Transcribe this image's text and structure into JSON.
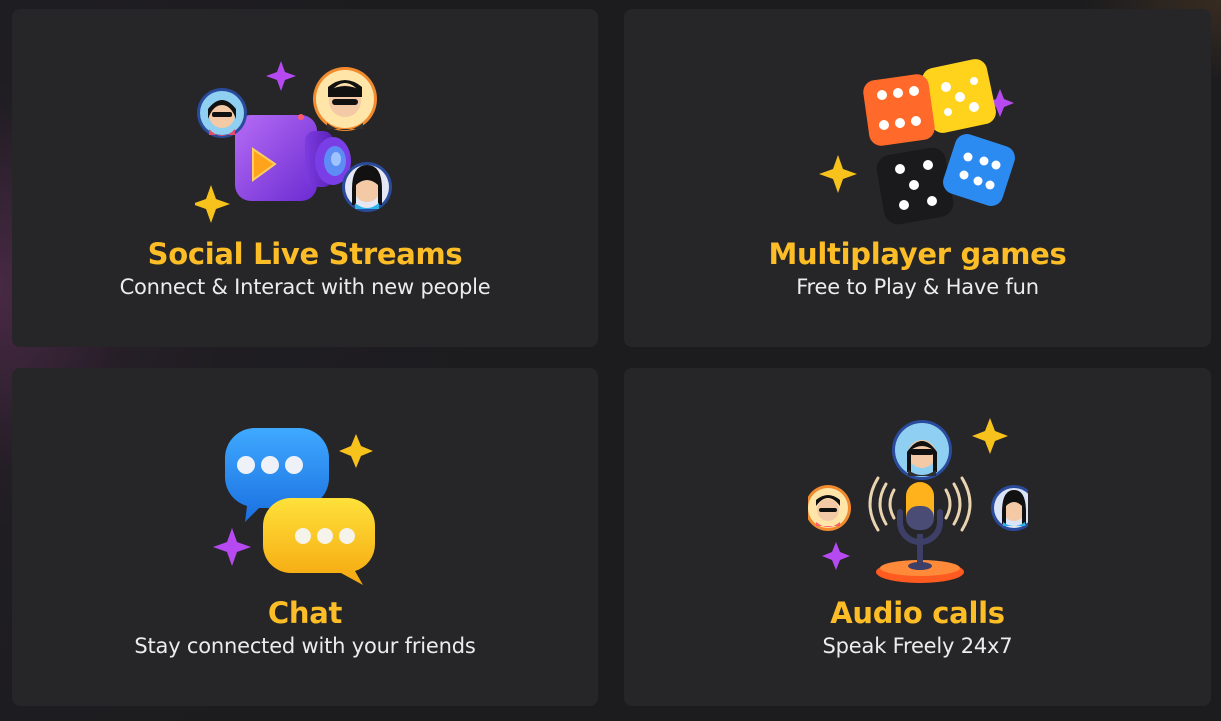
{
  "colors": {
    "card_background": "#262628",
    "title": "#fdbd26",
    "subtitle": "#ececec",
    "page_background": "#1c1c1e"
  },
  "features": [
    {
      "title": "Social Live Streams",
      "subtitle": "Connect & Interact with new people",
      "icon": "video-camera-avatars-icon"
    },
    {
      "title": "Multiplayer games",
      "subtitle": "Free to Play & Have fun",
      "icon": "dice-icon"
    },
    {
      "title": "Chat",
      "subtitle": "Stay connected with your friends",
      "icon": "chat-bubbles-icon"
    },
    {
      "title": "Audio calls",
      "subtitle": "Speak Freely 24x7",
      "icon": "microphone-avatars-icon"
    }
  ]
}
